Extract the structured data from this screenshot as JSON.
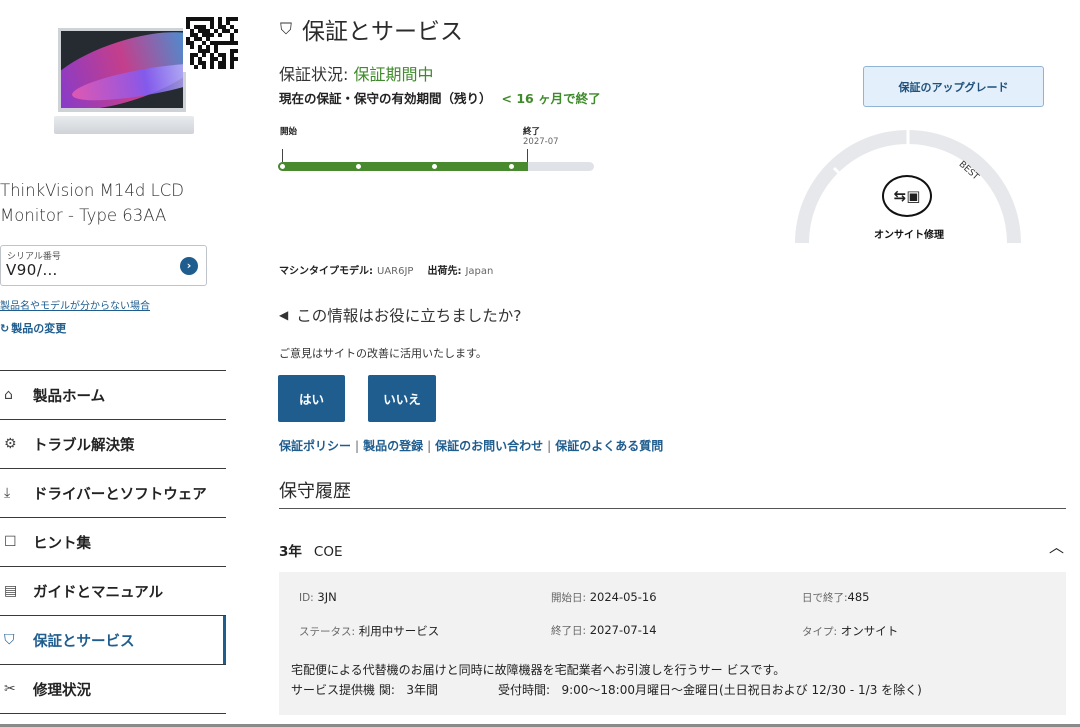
{
  "product": {
    "name_line1": "ThinkVision M14d LCD",
    "name_line2": "Monitor - Type 63AA",
    "serial_label": "シリアル番号",
    "serial_value": "V90/…",
    "help_link": "製品名やモデルが分からない場合",
    "change_product": "製品の変更"
  },
  "nav": [
    {
      "icon": "home-icon",
      "label": "製品ホーム"
    },
    {
      "icon": "wrench-cog-icon",
      "label": "トラブル解決策"
    },
    {
      "icon": "download-icon",
      "label": "ドライバーとソフトウェア"
    },
    {
      "icon": "book-icon",
      "label": "ヒント集"
    },
    {
      "icon": "manual-icon",
      "label": "ガイドとマニュアル"
    },
    {
      "icon": "shield-icon",
      "label": "保証とサービス",
      "active": true
    },
    {
      "icon": "tools-icon",
      "label": "修理状況"
    }
  ],
  "header": {
    "title": "保証とサービス"
  },
  "warranty": {
    "status_label": "保証状況: ",
    "status_value": "保証期間中",
    "remain_label": "現在の保証・保守の有効期間（残り）",
    "remain_value": "< 16 ヶ月で終了",
    "upgrade_button": "保証のアップグレード",
    "timeline_start": "開始",
    "timeline_end": "終了",
    "timeline_end_date": "2027-07",
    "elapsed_fraction": 0.79,
    "gauge_label": "オンサイト修理",
    "gauge_best": "BEST",
    "machine_type_label": "マシンタイプモデル:",
    "machine_type_value": "UAR6JP",
    "ship_to_label": "出荷先:",
    "ship_to_value": "Japan"
  },
  "feedback": {
    "title": "この情報はお役に立ちましたか?",
    "subtitle": "ご意見はサイトの改善に活用いたします。",
    "yes": "はい",
    "no": "いいえ"
  },
  "links": [
    "保証ポリシー",
    "製品の登録",
    "保証のお問い合わせ",
    "保証のよくある質問"
  ],
  "history": {
    "title": "保守履歴",
    "plan_years": "3年",
    "plan_name": "COE",
    "id_label": "ID:",
    "id_value": "3JN",
    "start_label": "開始日:",
    "start_value": "2024-05-16",
    "days_label": "日で終了:",
    "days_value": "485",
    "status_label": "ステータス:",
    "status_value": "利用中サービス",
    "end_label": "終了日:",
    "end_value": "2027-07-14",
    "type_label": "タイプ:",
    "type_value": "オンサイト",
    "description": "宅配便による代替機のお届けと同時に故障機器を宅配業者へお引渡しを行うサー ビスです。",
    "period_label": "サービス提供機 関:",
    "period_value": "3年間",
    "hours_label": "受付時間:",
    "hours_value": "9:00～18:00月曜日～金曜日(土日祝日および 12/30 - 1/3 を除く)"
  },
  "colors": {
    "brand_blue": "#1f5d8f",
    "status_green": "#3f8a2b",
    "timeline_green": "#4a8a2f"
  }
}
